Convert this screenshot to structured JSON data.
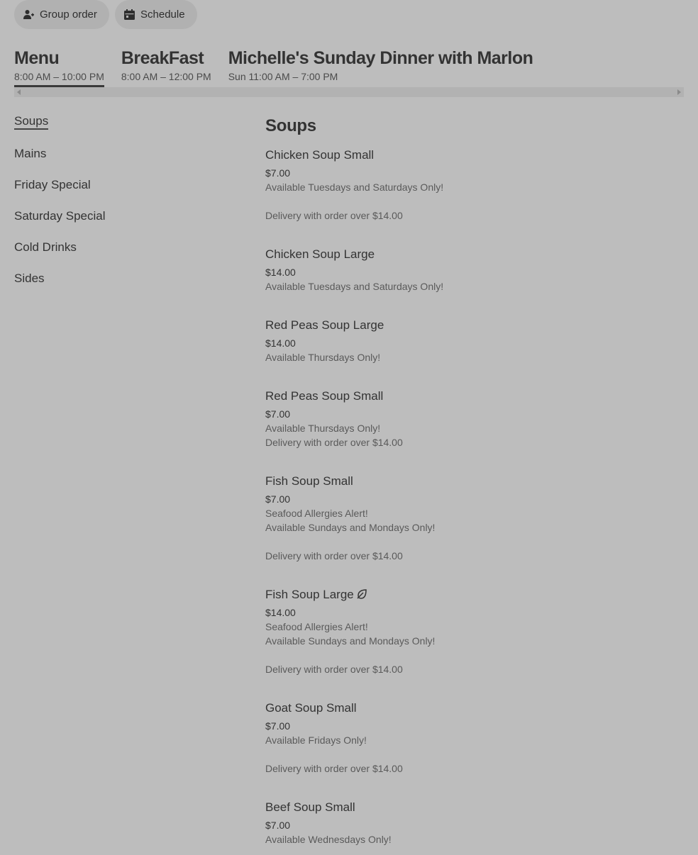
{
  "top_buttons": {
    "group_order": "Group order",
    "schedule": "Schedule"
  },
  "menus": [
    {
      "title": "Menu",
      "hours": "8:00 AM – 10:00 PM"
    },
    {
      "title": "BreakFast",
      "hours": "8:00 AM – 12:00 PM"
    },
    {
      "title": "Michelle's Sunday Dinner with Marlon",
      "hours": "Sun 11:00 AM – 7:00 PM"
    }
  ],
  "sidebar": {
    "items": [
      {
        "label": "Soups"
      },
      {
        "label": "Mains"
      },
      {
        "label": "Friday Special"
      },
      {
        "label": "Saturday Special"
      },
      {
        "label": "Cold Drinks"
      },
      {
        "label": "Sides"
      }
    ]
  },
  "section": {
    "title": "Soups"
  },
  "items": [
    {
      "name": "Chicken Soup Small",
      "price": "$7.00",
      "lines": [
        "Available Tuesdays and Saturdays Only!",
        "",
        "Delivery with order over $14.00"
      ]
    },
    {
      "name": "Chicken Soup Large",
      "price": "$14.00",
      "lines": [
        "Available Tuesdays and Saturdays Only!"
      ]
    },
    {
      "name": "Red Peas Soup Large",
      "price": "$14.00",
      "lines": [
        "Available Thursdays Only!"
      ]
    },
    {
      "name": "Red Peas Soup Small",
      "price": "$7.00",
      "lines": [
        "Available Thursdays Only!",
        "Delivery with order over $14.00"
      ]
    },
    {
      "name": "Fish Soup Small",
      "price": "$7.00",
      "lines": [
        "Seafood Allergies Alert!",
        "Available Sundays and Mondays Only!",
        "",
        "Delivery with order over $14.00"
      ]
    },
    {
      "name": "Fish Soup Large",
      "price": "$14.00",
      "icon": "leaf-icon",
      "lines": [
        "Seafood Allergies Alert!",
        "Available Sundays and Mondays Only!",
        "",
        "Delivery with order over $14.00"
      ]
    },
    {
      "name": "Goat Soup Small",
      "price": "$7.00",
      "lines": [
        "Available Fridays Only!",
        "",
        "Delivery with order over $14.00"
      ]
    },
    {
      "name": "Beef Soup Small",
      "price": "$7.00",
      "lines": [
        "Available Wednesdays Only!"
      ]
    }
  ]
}
